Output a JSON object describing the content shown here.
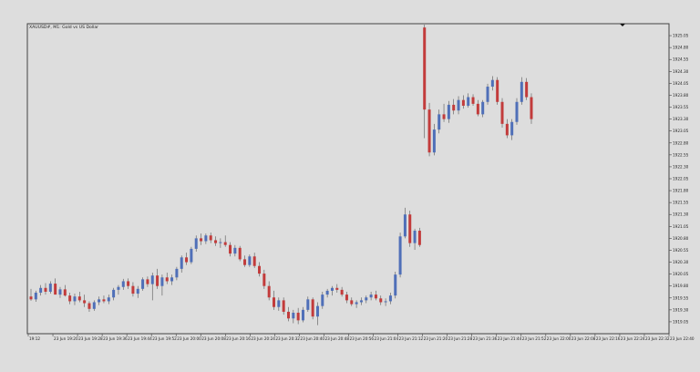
{
  "symbol_label": "XAUUSD#, M1:  Gold vs US Dollar",
  "colors": {
    "background": "#dddddd",
    "plot_background": "#dddddd",
    "frame": "#444444",
    "bull_candle": "#4f6fb8",
    "bear_candle": "#c23b3b",
    "wick": "#555555",
    "text": "#222222"
  },
  "chart_data": {
    "type": "candlestick",
    "title": "XAUUSD#, M1:  Gold vs US Dollar",
    "ylim": [
      1918.8,
      1925.3
    ],
    "y_ticks": [
      "1925.05",
      "1924.80",
      "1924.55",
      "1924.30",
      "1924.05",
      "1923.80",
      "1923.55",
      "1923.30",
      "1923.05",
      "1922.80",
      "1922.55",
      "1922.30",
      "1922.05",
      "1921.80",
      "1921.55",
      "1921.30",
      "1921.05",
      "1920.80",
      "1920.55",
      "1920.30",
      "1920.05",
      "1919.80",
      "1919.55",
      "1919.30",
      "1919.05"
    ],
    "y_tick_values": [
      1925.05,
      1924.8,
      1924.55,
      1924.3,
      1924.05,
      1923.8,
      1923.55,
      1923.3,
      1923.05,
      1922.8,
      1922.55,
      1922.3,
      1922.05,
      1921.8,
      1921.55,
      1921.3,
      1921.05,
      1920.8,
      1920.55,
      1920.3,
      1920.05,
      1919.8,
      1919.55,
      1919.3,
      1919.05
    ],
    "x_ticks": [
      "19:12",
      "23 Jun 19:20",
      "23 Jun 19:28",
      "23 Jun 19:36",
      "23 Jun 19:44",
      "23 Jun 19:52",
      "23 Jun 20:00",
      "23 Jun 20:08",
      "23 Jun 20:16",
      "23 Jun 20:24",
      "23 Jun 20:32",
      "23 Jun 20:40",
      "23 Jun 20:48",
      "23 Jun 20:56",
      "23 Jun 21:04",
      "23 Jun 21:12",
      "23 Jun 21:20",
      "23 Jun 21:28",
      "23 Jun 21:36",
      "23 Jun 21:44",
      "23 Jun 21:52",
      "23 Jun 22:00",
      "23 Jun 22:08",
      "23 Jun 22:16",
      "23 Jun 22:24",
      "23 Jun 22:32",
      "23 Jun 22:40"
    ],
    "grid": false,
    "candles": [
      {
        "o": 1919.58,
        "h": 1919.74,
        "l": 1919.49,
        "c": 1919.52
      },
      {
        "o": 1919.52,
        "h": 1919.7,
        "l": 1919.47,
        "c": 1919.66
      },
      {
        "o": 1919.66,
        "h": 1919.82,
        "l": 1919.6,
        "c": 1919.76
      },
      {
        "o": 1919.76,
        "h": 1919.86,
        "l": 1919.62,
        "c": 1919.68
      },
      {
        "o": 1919.68,
        "h": 1919.9,
        "l": 1919.64,
        "c": 1919.85
      },
      {
        "o": 1919.85,
        "h": 1919.96,
        "l": 1919.7,
        "c": 1919.62
      },
      {
        "o": 1919.62,
        "h": 1919.78,
        "l": 1919.55,
        "c": 1919.73
      },
      {
        "o": 1919.73,
        "h": 1919.82,
        "l": 1919.58,
        "c": 1919.6
      },
      {
        "o": 1919.6,
        "h": 1919.66,
        "l": 1919.42,
        "c": 1919.48
      },
      {
        "o": 1919.48,
        "h": 1919.64,
        "l": 1919.4,
        "c": 1919.58
      },
      {
        "o": 1919.58,
        "h": 1919.68,
        "l": 1919.46,
        "c": 1919.5
      },
      {
        "o": 1919.5,
        "h": 1919.62,
        "l": 1919.36,
        "c": 1919.44
      },
      {
        "o": 1919.44,
        "h": 1919.48,
        "l": 1919.26,
        "c": 1919.32
      },
      {
        "o": 1919.32,
        "h": 1919.5,
        "l": 1919.28,
        "c": 1919.46
      },
      {
        "o": 1919.46,
        "h": 1919.58,
        "l": 1919.4,
        "c": 1919.52
      },
      {
        "o": 1919.52,
        "h": 1919.6,
        "l": 1919.44,
        "c": 1919.48
      },
      {
        "o": 1919.48,
        "h": 1919.62,
        "l": 1919.42,
        "c": 1919.56
      },
      {
        "o": 1919.56,
        "h": 1919.76,
        "l": 1919.5,
        "c": 1919.72
      },
      {
        "o": 1919.72,
        "h": 1919.82,
        "l": 1919.62,
        "c": 1919.78
      },
      {
        "o": 1919.78,
        "h": 1919.95,
        "l": 1919.72,
        "c": 1919.9
      },
      {
        "o": 1919.9,
        "h": 1919.96,
        "l": 1919.74,
        "c": 1919.8
      },
      {
        "o": 1919.8,
        "h": 1919.88,
        "l": 1919.58,
        "c": 1919.64
      },
      {
        "o": 1919.64,
        "h": 1919.8,
        "l": 1919.55,
        "c": 1919.74
      },
      {
        "o": 1919.74,
        "h": 1919.98,
        "l": 1919.7,
        "c": 1919.94
      },
      {
        "o": 1919.94,
        "h": 1920.0,
        "l": 1919.78,
        "c": 1919.84
      },
      {
        "o": 1919.84,
        "h": 1920.08,
        "l": 1919.5,
        "c": 1920.02
      },
      {
        "o": 1920.02,
        "h": 1920.16,
        "l": 1919.74,
        "c": 1919.8
      },
      {
        "o": 1919.8,
        "h": 1920.04,
        "l": 1919.6,
        "c": 1919.98
      },
      {
        "o": 1919.98,
        "h": 1920.08,
        "l": 1919.84,
        "c": 1919.9
      },
      {
        "o": 1919.9,
        "h": 1920.04,
        "l": 1919.82,
        "c": 1919.98
      },
      {
        "o": 1919.98,
        "h": 1920.2,
        "l": 1919.92,
        "c": 1920.16
      },
      {
        "o": 1920.16,
        "h": 1920.44,
        "l": 1920.08,
        "c": 1920.4
      },
      {
        "o": 1920.4,
        "h": 1920.5,
        "l": 1920.24,
        "c": 1920.3
      },
      {
        "o": 1920.3,
        "h": 1920.62,
        "l": 1920.26,
        "c": 1920.58
      },
      {
        "o": 1920.58,
        "h": 1920.86,
        "l": 1920.52,
        "c": 1920.8
      },
      {
        "o": 1920.8,
        "h": 1920.9,
        "l": 1920.66,
        "c": 1920.74
      },
      {
        "o": 1920.74,
        "h": 1920.9,
        "l": 1920.68,
        "c": 1920.86
      },
      {
        "o": 1920.86,
        "h": 1920.92,
        "l": 1920.7,
        "c": 1920.76
      },
      {
        "o": 1920.76,
        "h": 1920.84,
        "l": 1920.64,
        "c": 1920.7
      },
      {
        "o": 1920.7,
        "h": 1920.8,
        "l": 1920.6,
        "c": 1920.72
      },
      {
        "o": 1920.72,
        "h": 1920.86,
        "l": 1920.62,
        "c": 1920.66
      },
      {
        "o": 1920.66,
        "h": 1920.72,
        "l": 1920.42,
        "c": 1920.48
      },
      {
        "o": 1920.48,
        "h": 1920.66,
        "l": 1920.42,
        "c": 1920.6
      },
      {
        "o": 1920.6,
        "h": 1920.64,
        "l": 1920.32,
        "c": 1920.36
      },
      {
        "o": 1920.36,
        "h": 1920.44,
        "l": 1920.2,
        "c": 1920.24
      },
      {
        "o": 1920.24,
        "h": 1920.46,
        "l": 1920.2,
        "c": 1920.42
      },
      {
        "o": 1920.42,
        "h": 1920.5,
        "l": 1920.18,
        "c": 1920.22
      },
      {
        "o": 1920.22,
        "h": 1920.3,
        "l": 1920.0,
        "c": 1920.06
      },
      {
        "o": 1920.06,
        "h": 1920.14,
        "l": 1919.74,
        "c": 1919.8
      },
      {
        "o": 1919.8,
        "h": 1919.9,
        "l": 1919.5,
        "c": 1919.56
      },
      {
        "o": 1919.56,
        "h": 1919.7,
        "l": 1919.3,
        "c": 1919.36
      },
      {
        "o": 1919.36,
        "h": 1919.56,
        "l": 1919.28,
        "c": 1919.5
      },
      {
        "o": 1919.5,
        "h": 1919.56,
        "l": 1919.2,
        "c": 1919.26
      },
      {
        "o": 1919.26,
        "h": 1919.36,
        "l": 1919.06,
        "c": 1919.12
      },
      {
        "o": 1919.12,
        "h": 1919.3,
        "l": 1919.02,
        "c": 1919.24
      },
      {
        "o": 1919.24,
        "h": 1919.34,
        "l": 1919.0,
        "c": 1919.08
      },
      {
        "o": 1919.08,
        "h": 1919.36,
        "l": 1919.04,
        "c": 1919.3
      },
      {
        "o": 1919.3,
        "h": 1919.58,
        "l": 1919.26,
        "c": 1919.52
      },
      {
        "o": 1919.52,
        "h": 1919.56,
        "l": 1919.1,
        "c": 1919.16
      },
      {
        "o": 1919.16,
        "h": 1919.46,
        "l": 1918.98,
        "c": 1919.38
      },
      {
        "o": 1919.38,
        "h": 1919.68,
        "l": 1919.32,
        "c": 1919.62
      },
      {
        "o": 1919.62,
        "h": 1919.74,
        "l": 1919.56,
        "c": 1919.7
      },
      {
        "o": 1919.7,
        "h": 1919.8,
        "l": 1919.6,
        "c": 1919.76
      },
      {
        "o": 1919.76,
        "h": 1919.84,
        "l": 1919.66,
        "c": 1919.72
      },
      {
        "o": 1919.72,
        "h": 1919.78,
        "l": 1919.58,
        "c": 1919.62
      },
      {
        "o": 1919.62,
        "h": 1919.68,
        "l": 1919.44,
        "c": 1919.5
      },
      {
        "o": 1919.5,
        "h": 1919.56,
        "l": 1919.38,
        "c": 1919.42
      },
      {
        "o": 1919.42,
        "h": 1919.5,
        "l": 1919.34,
        "c": 1919.46
      },
      {
        "o": 1919.46,
        "h": 1919.56,
        "l": 1919.4,
        "c": 1919.5
      },
      {
        "o": 1919.5,
        "h": 1919.6,
        "l": 1919.44,
        "c": 1919.56
      },
      {
        "o": 1919.56,
        "h": 1919.68,
        "l": 1919.5,
        "c": 1919.62
      },
      {
        "o": 1919.62,
        "h": 1919.7,
        "l": 1919.5,
        "c": 1919.54
      },
      {
        "o": 1919.54,
        "h": 1919.6,
        "l": 1919.4,
        "c": 1919.46
      },
      {
        "o": 1919.46,
        "h": 1919.54,
        "l": 1919.38,
        "c": 1919.48
      },
      {
        "o": 1919.48,
        "h": 1919.66,
        "l": 1919.42,
        "c": 1919.6
      },
      {
        "o": 1919.6,
        "h": 1920.1,
        "l": 1919.54,
        "c": 1920.04
      },
      {
        "o": 1920.04,
        "h": 1920.92,
        "l": 1919.98,
        "c": 1920.84
      },
      {
        "o": 1920.84,
        "h": 1921.44,
        "l": 1920.8,
        "c": 1921.3
      },
      {
        "o": 1921.3,
        "h": 1921.38,
        "l": 1920.62,
        "c": 1920.7
      },
      {
        "o": 1920.7,
        "h": 1921.0,
        "l": 1920.56,
        "c": 1920.96
      },
      {
        "o": 1920.96,
        "h": 1921.02,
        "l": 1920.62,
        "c": 1920.66
      },
      {
        "o": 1925.22,
        "h": 1925.28,
        "l": 1922.9,
        "c": 1923.5
      },
      {
        "o": 1923.5,
        "h": 1923.64,
        "l": 1922.52,
        "c": 1922.6
      },
      {
        "o": 1922.6,
        "h": 1923.2,
        "l": 1922.54,
        "c": 1923.08
      },
      {
        "o": 1923.08,
        "h": 1923.5,
        "l": 1923.0,
        "c": 1923.4
      },
      {
        "o": 1923.4,
        "h": 1923.62,
        "l": 1923.24,
        "c": 1923.3
      },
      {
        "o": 1923.3,
        "h": 1923.68,
        "l": 1923.22,
        "c": 1923.6
      },
      {
        "o": 1923.6,
        "h": 1923.72,
        "l": 1923.4,
        "c": 1923.48
      },
      {
        "o": 1923.48,
        "h": 1923.78,
        "l": 1923.4,
        "c": 1923.7
      },
      {
        "o": 1923.7,
        "h": 1923.8,
        "l": 1923.52,
        "c": 1923.58
      },
      {
        "o": 1923.58,
        "h": 1923.84,
        "l": 1923.54,
        "c": 1923.76
      },
      {
        "o": 1923.76,
        "h": 1923.82,
        "l": 1923.58,
        "c": 1923.62
      },
      {
        "o": 1923.62,
        "h": 1923.7,
        "l": 1923.36,
        "c": 1923.4
      },
      {
        "o": 1923.4,
        "h": 1923.7,
        "l": 1923.34,
        "c": 1923.66
      },
      {
        "o": 1923.66,
        "h": 1924.04,
        "l": 1923.6,
        "c": 1923.98
      },
      {
        "o": 1923.98,
        "h": 1924.2,
        "l": 1923.9,
        "c": 1924.12
      },
      {
        "o": 1924.12,
        "h": 1924.18,
        "l": 1923.6,
        "c": 1923.66
      },
      {
        "o": 1923.66,
        "h": 1923.74,
        "l": 1923.12,
        "c": 1923.2
      },
      {
        "o": 1923.2,
        "h": 1923.3,
        "l": 1922.9,
        "c": 1922.96
      },
      {
        "o": 1922.96,
        "h": 1923.3,
        "l": 1922.86,
        "c": 1923.24
      },
      {
        "o": 1923.24,
        "h": 1923.74,
        "l": 1923.18,
        "c": 1923.66
      },
      {
        "o": 1923.66,
        "h": 1924.18,
        "l": 1923.6,
        "c": 1924.08
      },
      {
        "o": 1924.08,
        "h": 1924.16,
        "l": 1923.7,
        "c": 1923.76
      },
      {
        "o": 1923.76,
        "h": 1923.84,
        "l": 1923.2,
        "c": 1923.3
      }
    ]
  }
}
